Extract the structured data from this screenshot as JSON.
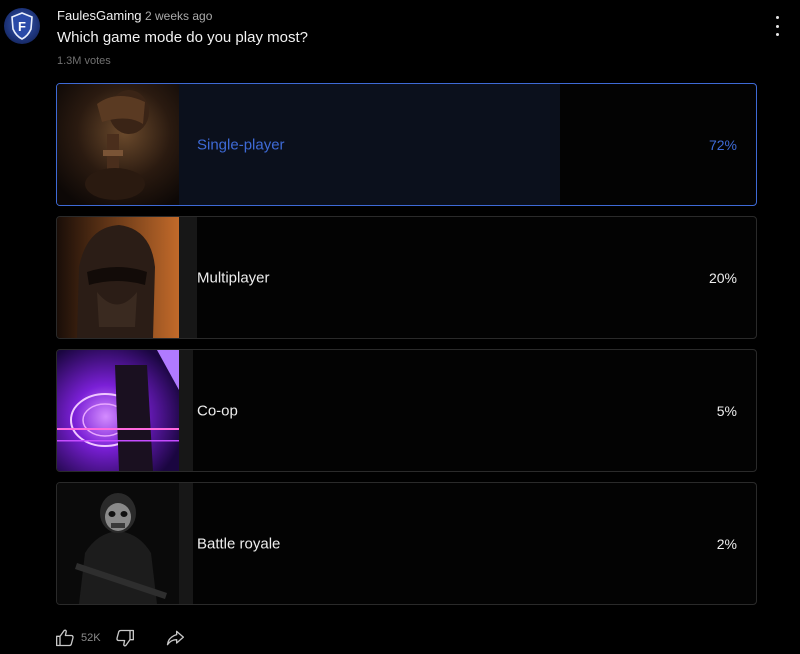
{
  "post": {
    "author": "FaulesGaming",
    "time": "2 weeks ago",
    "question": "Which game mode do you play most?",
    "votes": "1.3M votes",
    "avatar_letter": "F"
  },
  "poll": {
    "options": [
      {
        "label": "Single-player",
        "percent": "72%",
        "share": 0.72,
        "selected": true,
        "thumb": "samurai-image"
      },
      {
        "label": "Multiplayer",
        "percent": "20%",
        "share": 0.2,
        "selected": false,
        "thumb": "helmet-image"
      },
      {
        "label": "Co-op",
        "percent": "5%",
        "share": 0.05,
        "selected": false,
        "thumb": "neon-portal-image"
      },
      {
        "label": "Battle royale",
        "percent": "2%",
        "share": 0.02,
        "selected": false,
        "thumb": "skull-soldier-image"
      }
    ]
  },
  "actions": {
    "likes": "52K",
    "icons": [
      "thumbs-up-icon",
      "thumbs-down-icon",
      "share-icon"
    ]
  },
  "colors": {
    "accent": "#3e6ad6",
    "background": "#000000",
    "text": "#f1f1f1",
    "muted": "#aaaaaa"
  }
}
